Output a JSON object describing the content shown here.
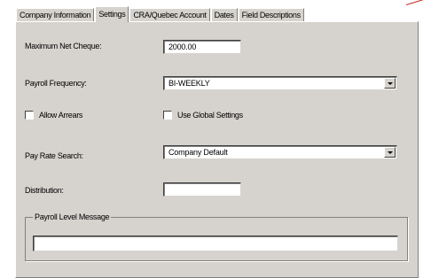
{
  "tabs": [
    {
      "label": "Company Information",
      "active": false
    },
    {
      "label": "Settings",
      "active": true
    },
    {
      "label": "CRA/Quebec Account",
      "active": false
    },
    {
      "label": "Dates",
      "active": false
    },
    {
      "label": "Field Descriptions",
      "active": false
    }
  ],
  "settings": {
    "max_net_cheque_label": "Maximum Net Cheque:",
    "max_net_cheque_value": "2000.00",
    "payroll_frequency_label": "Payroll Frequency:",
    "payroll_frequency_value": "BI-WEEKLY",
    "allow_arrears_label": "Allow Arrears",
    "allow_arrears_checked": false,
    "use_global_label": "Use Global Settings",
    "use_global_checked": false,
    "pay_rate_search_label": "Pay Rate Search:",
    "pay_rate_search_value": "Company Default",
    "distribution_label": "Distribution:",
    "distribution_value": "",
    "payroll_message_label": "Payroll Level Message",
    "payroll_message_value": ""
  },
  "colors": {
    "panel": "#d6d3ce",
    "annotation_line": "#cc2222"
  }
}
